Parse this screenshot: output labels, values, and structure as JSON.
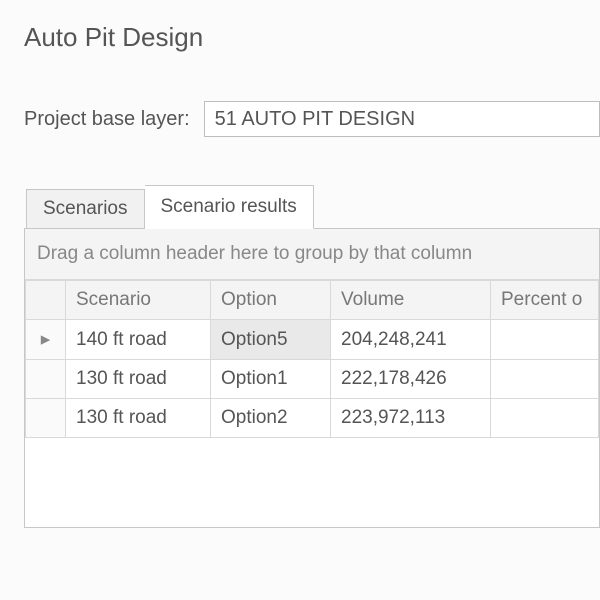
{
  "title": "Auto Pit Design",
  "field": {
    "label": "Project base layer:",
    "value": "51 AUTO PIT DESIGN"
  },
  "tabs": {
    "scenarios": "Scenarios",
    "results": "Scenario results"
  },
  "group_hint": "Drag a column header here to group by that column",
  "columns": {
    "scenario": "Scenario",
    "option": "Option",
    "volume": "Volume",
    "percent": "Percent o"
  },
  "row_indicator": "▸",
  "rows": [
    {
      "scenario": "140 ft road",
      "option": "Option5",
      "volume": "204,248,241",
      "percent": ""
    },
    {
      "scenario": "130 ft road",
      "option": "Option1",
      "volume": "222,178,426",
      "percent": ""
    },
    {
      "scenario": "130 ft road",
      "option": "Option2",
      "volume": "223,972,113",
      "percent": ""
    }
  ]
}
